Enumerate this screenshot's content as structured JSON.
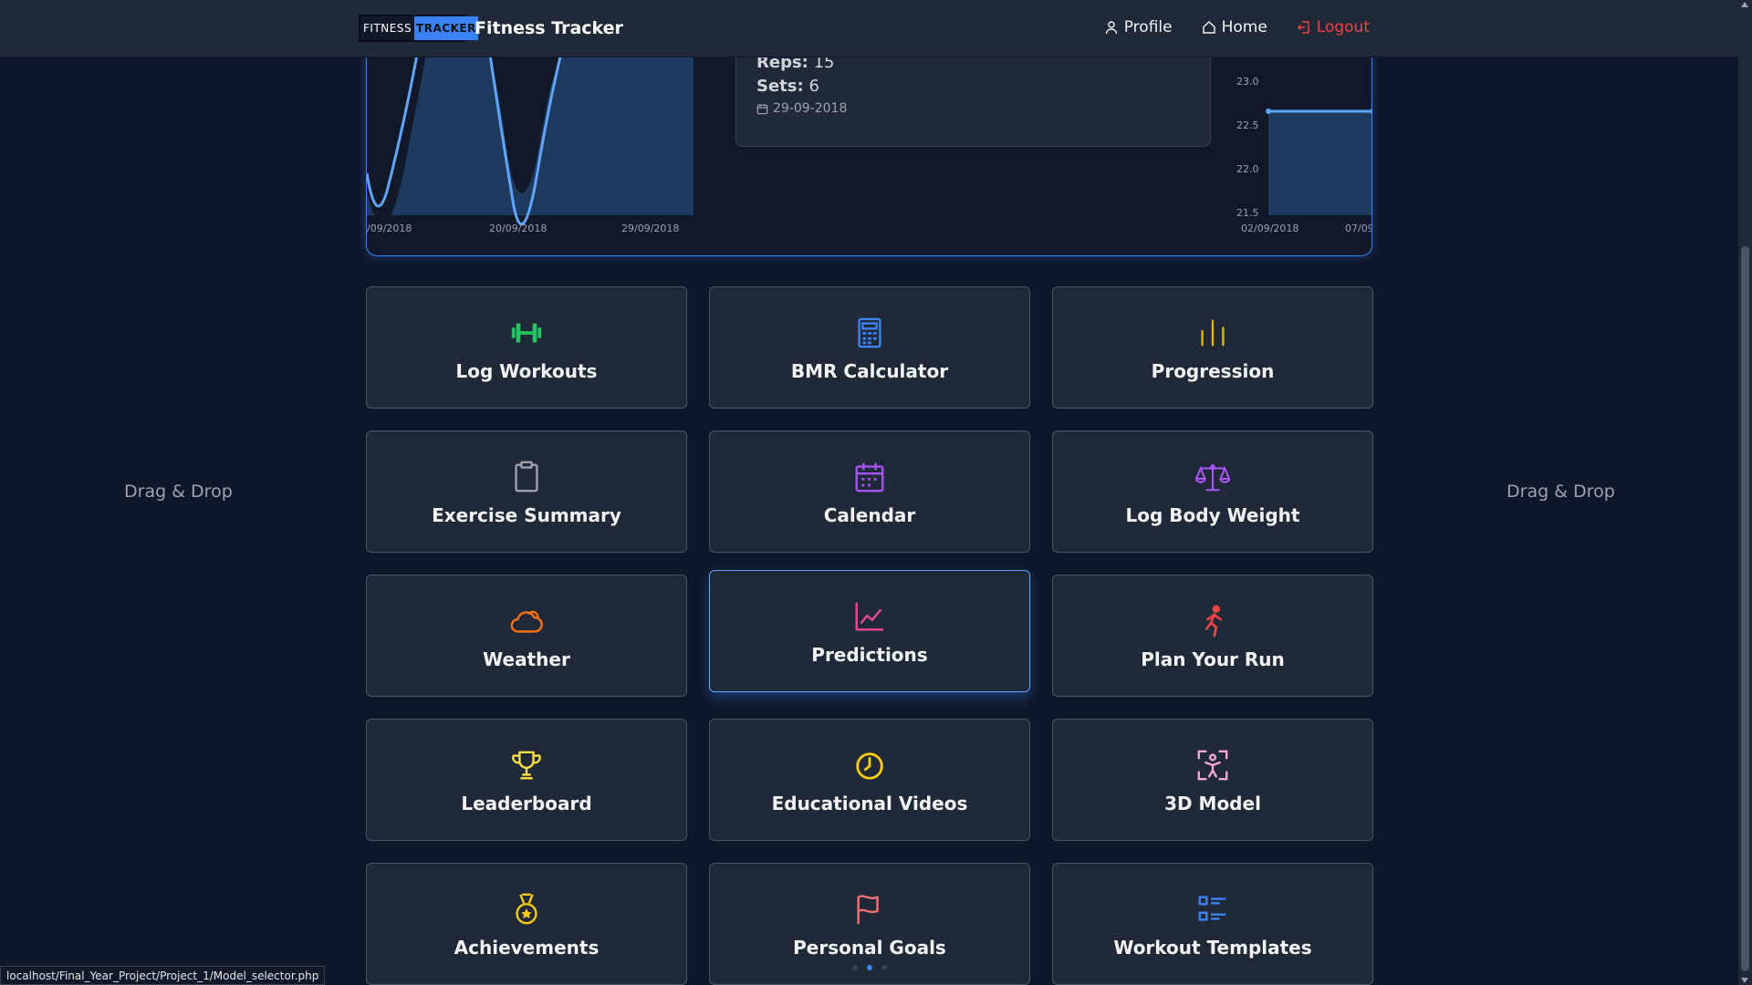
{
  "nav": {
    "logo_part1": "FITNESS",
    "logo_part2": "TRACKER",
    "title": "Fitness Tracker",
    "profile": "Profile",
    "home": "Home",
    "logout": "Logout"
  },
  "carousel": {
    "left_chart_ticks": [
      "/09/2018",
      "20/09/2018",
      "29/09/2018"
    ],
    "info": {
      "reps_label": "Reps:",
      "reps_value": "15",
      "sets_label": "Sets:",
      "sets_value": "6",
      "date": "29-09-2018"
    },
    "right_chart_yticks": [
      "23.0",
      "22.5",
      "22.0",
      "21.5"
    ],
    "right_chart_xticks": [
      "02/09/2018",
      "07/09"
    ]
  },
  "side": {
    "left": "Drag & Drop",
    "right": "Drag & Drop"
  },
  "tiles": [
    {
      "label": "Log Workouts",
      "icon": "dumbbell-icon",
      "color": "#22c55e"
    },
    {
      "label": "BMR Calculator",
      "icon": "calculator-icon",
      "color": "#3b82f6"
    },
    {
      "label": "Progression",
      "icon": "bar-chart-icon",
      "color": "#eab308"
    },
    {
      "label": "Exercise Summary",
      "icon": "clipboard-icon",
      "color": "#9ca3af"
    },
    {
      "label": "Calendar",
      "icon": "calendar-icon",
      "color": "#a855f7"
    },
    {
      "label": "Log Body Weight",
      "icon": "scale-icon",
      "color": "#a855f7"
    },
    {
      "label": "Weather",
      "icon": "cloud-sun-icon",
      "color": "#f97316"
    },
    {
      "label": "Predictions",
      "icon": "line-chart-icon",
      "color": "#ec4899"
    },
    {
      "label": "Plan Your Run",
      "icon": "runner-icon",
      "color": "#ef4444"
    },
    {
      "label": "Leaderboard",
      "icon": "trophy-icon",
      "color": "#fde047"
    },
    {
      "label": "Educational Videos",
      "icon": "clock-play-icon",
      "color": "#facc15"
    },
    {
      "label": "3D Model",
      "icon": "body-scan-icon",
      "color": "#f9a8d4"
    },
    {
      "label": "Achievements",
      "icon": "medal-icon",
      "color": "#facc15"
    },
    {
      "label": "Personal Goals",
      "icon": "flag-icon",
      "color": "#f87171"
    },
    {
      "label": "Workout Templates",
      "icon": "list-icon",
      "color": "#3b82f6"
    }
  ],
  "status_url": "localhost/Final_Year_Project/Project_1/Model_selector.php"
}
